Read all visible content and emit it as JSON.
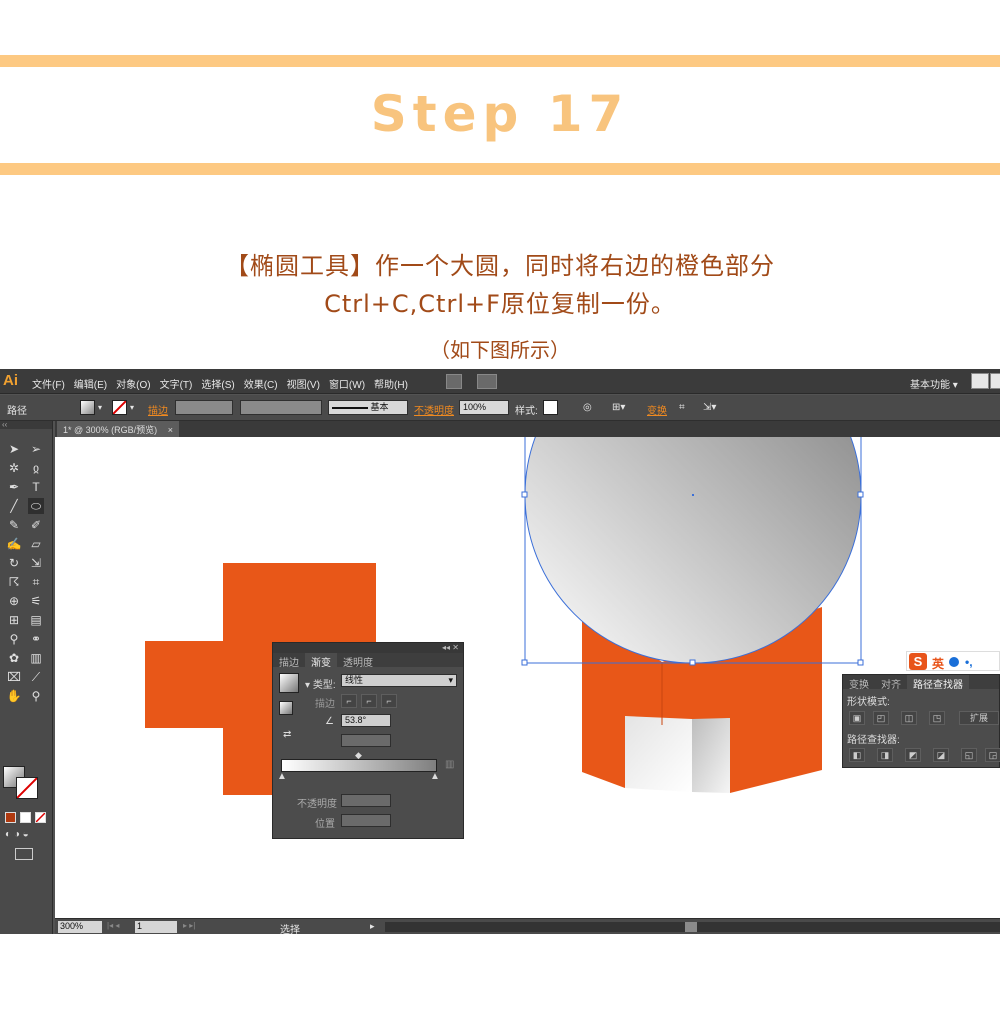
{
  "header": {
    "title": "Step 17",
    "line1": "【椭圆工具】作一个大圆，同时将右边的橙色部分",
    "line2": "Ctrl+C,Ctrl+F原位复制一份。",
    "note": "（如下图所示）"
  },
  "app": {
    "logo": "Ai",
    "menu": [
      "文件(F)",
      "编辑(E)",
      "对象(O)",
      "文字(T)",
      "选择(S)",
      "效果(C)",
      "视图(V)",
      "窗口(W)",
      "帮助(H)"
    ],
    "workspace": "基本功能",
    "control": {
      "label_path": "路径",
      "label_stroke": "描边",
      "stroke_profile": "基本",
      "label_opacity": "不透明度",
      "opacity_value": "100%",
      "label_style": "样式",
      "label_transform": "变换"
    },
    "document_tab": "1* @ 300% (RGB/预览)",
    "document_tab_close": "×",
    "status": {
      "zoom": "300%",
      "page": "1",
      "mode": "选择"
    },
    "tool_grip": "‹‹",
    "tools": [
      "selection-icon",
      "direct-selection-icon",
      "magic-wand-icon",
      "lasso-icon",
      "pen-icon",
      "type-icon",
      "line-icon",
      "ellipse-icon",
      "brush-icon",
      "pencil-icon",
      "blob-brush-icon",
      "eraser-icon",
      "rotate-icon",
      "scale-icon",
      "warp-icon",
      "free-transform-icon",
      "shape-builder-icon",
      "graph-icon",
      "mesh-icon",
      "gradient-icon",
      "eyedropper-icon",
      "blend-icon",
      "symbol-icon",
      "column-graph-icon",
      "artboard-icon",
      "slice-icon",
      "hand-icon",
      "zoom-icon"
    ]
  },
  "gradient_panel": {
    "tabs": [
      "描边",
      "渐变",
      "透明度"
    ],
    "active_tab": 1,
    "type_label": "类型",
    "type_value": "线性",
    "stroke_label": "描边",
    "angle_value": "53.8°",
    "opacity_label": "不透明度",
    "position_label": "位置"
  },
  "pathfinder_panel": {
    "tabs": [
      "变换",
      "对齐",
      "路径查找器"
    ],
    "active_tab": 2,
    "shape_modes_label": "形状模式",
    "expand_label": "扩展",
    "pathfinders_label": "路径查找器"
  },
  "ime": {
    "logo": "S",
    "lang": "英",
    "punct": "•,"
  },
  "colors": {
    "orange": "#e85718",
    "accent": "#f8c47e",
    "text_brown": "#a14a18",
    "selection": "#3b6fd8"
  }
}
